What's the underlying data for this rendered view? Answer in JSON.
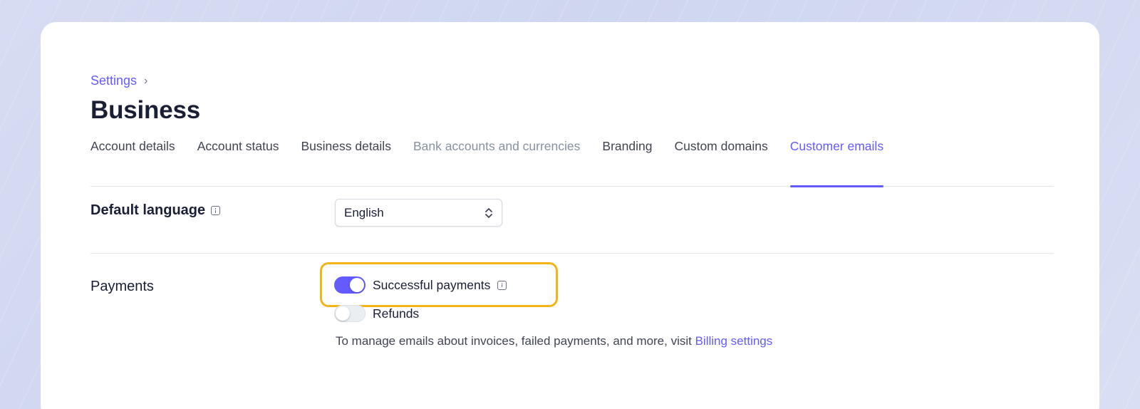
{
  "breadcrumb": {
    "parent": "Settings"
  },
  "page": {
    "title": "Business"
  },
  "tabs": [
    {
      "label": "Account details",
      "state": "normal"
    },
    {
      "label": "Account status",
      "state": "normal"
    },
    {
      "label": "Business details",
      "state": "normal"
    },
    {
      "label": "Bank accounts and currencies",
      "state": "muted"
    },
    {
      "label": "Branding",
      "state": "normal"
    },
    {
      "label": "Custom domains",
      "state": "normal"
    },
    {
      "label": "Customer emails",
      "state": "active"
    }
  ],
  "default_language": {
    "label": "Default language",
    "selected": "English"
  },
  "payments": {
    "label": "Payments",
    "toggles": [
      {
        "label": "Successful payments",
        "on": true
      },
      {
        "label": "Refunds",
        "on": false
      }
    ],
    "note_text": "To manage emails about invoices, failed payments, and more, visit ",
    "note_link": "Billing settings"
  },
  "colors": {
    "accent": "#635bff",
    "highlight": "#f2b416",
    "text": "#1a1f36",
    "muted": "#8792a2"
  }
}
